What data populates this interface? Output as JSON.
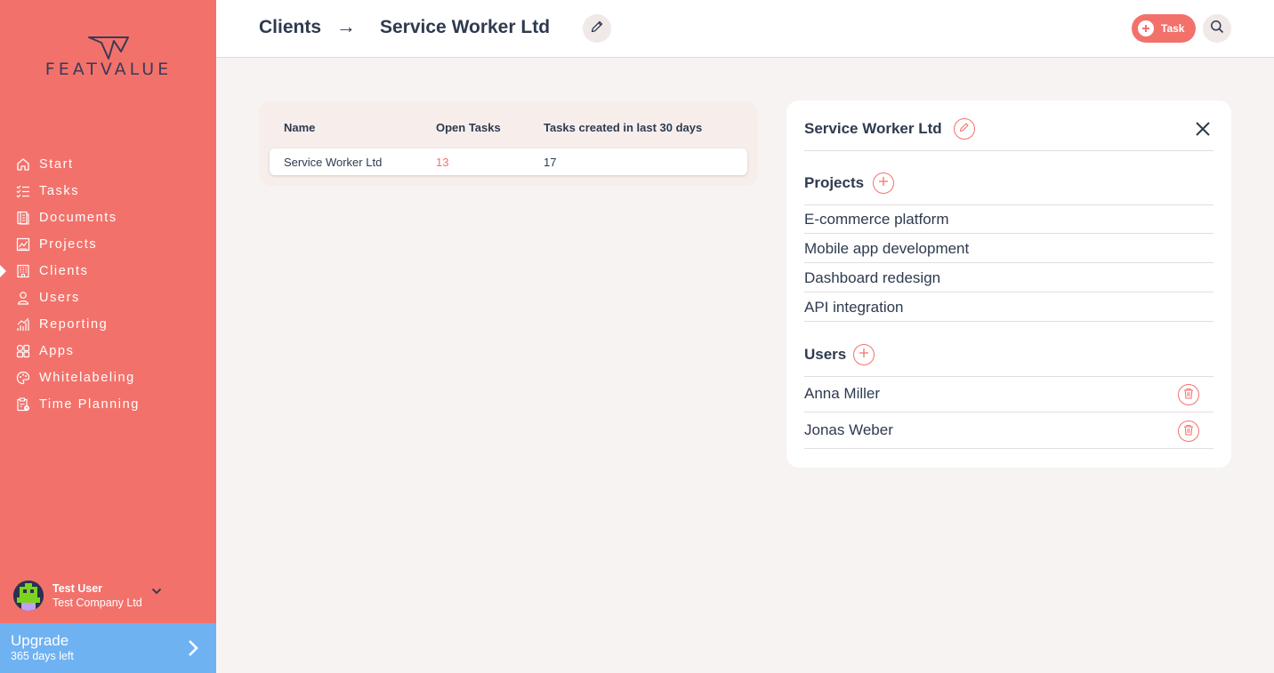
{
  "app": {
    "logo_text": "FEATVALUE"
  },
  "sidebar": {
    "items": [
      {
        "label": "Start",
        "icon": "home-icon"
      },
      {
        "label": "Tasks",
        "icon": "tasks-icon"
      },
      {
        "label": "Documents",
        "icon": "documents-icon"
      },
      {
        "label": "Projects",
        "icon": "projects-icon"
      },
      {
        "label": "Clients",
        "icon": "clients-icon",
        "active": true
      },
      {
        "label": "Users",
        "icon": "user-icon"
      },
      {
        "label": "Reporting",
        "icon": "reporting-icon"
      },
      {
        "label": "Apps",
        "icon": "apps-icon"
      },
      {
        "label": "Whitelabeling",
        "icon": "palette-icon"
      },
      {
        "label": "Time Planning",
        "icon": "time-planning-icon"
      }
    ],
    "user": {
      "name": "Test User",
      "company": "Test Company Ltd"
    },
    "upgrade": {
      "title": "Upgrade",
      "subtitle": "365 days left"
    }
  },
  "header": {
    "breadcrumb_parent": "Clients",
    "breadcrumb_arrow": "→",
    "breadcrumb_current": "Service Worker Ltd",
    "task_button_label": "Task"
  },
  "table": {
    "columns": [
      "Name",
      "Open Tasks",
      "Tasks created in last 30 days"
    ],
    "rows": [
      {
        "name": "Service Worker Ltd",
        "open_tasks": "13",
        "tasks_30_days": "17"
      }
    ]
  },
  "panel": {
    "title": "Service Worker Ltd",
    "projects_title": "Projects",
    "projects": [
      "E-commerce platform",
      "Mobile app development",
      "Dashboard redesign",
      "API integration"
    ],
    "users_title": "Users",
    "users": [
      "Anna Miller",
      "Jonas Weber"
    ]
  },
  "colors": {
    "accent": "#f2726b",
    "upgrade": "#6fb2f2",
    "text": "#2e3a4f",
    "background": "#f7f3f2"
  }
}
